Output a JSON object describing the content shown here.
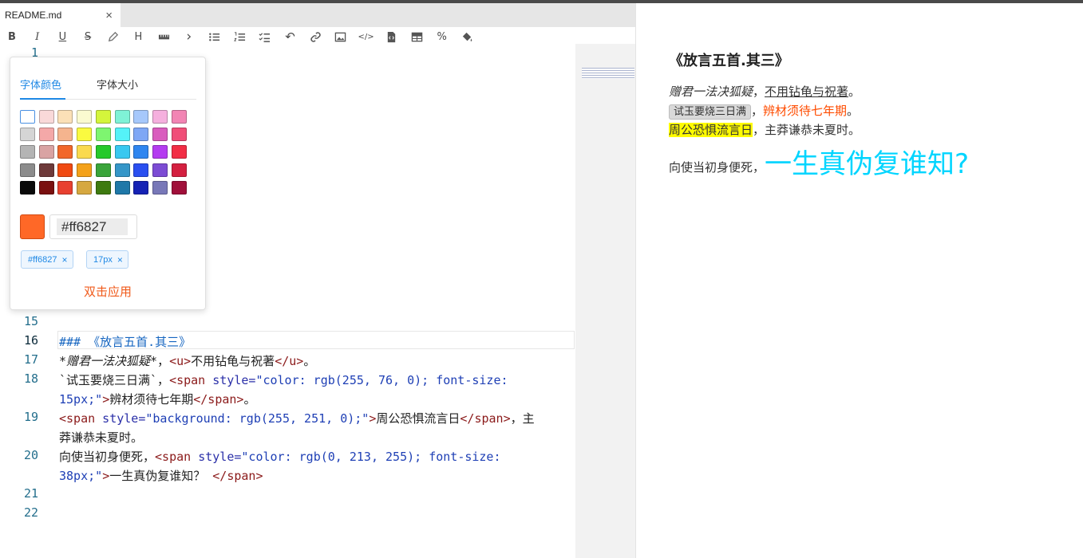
{
  "tab": {
    "title": "README.md",
    "close": "×"
  },
  "toolbar": [
    {
      "name": "bold-icon",
      "glyph": "B"
    },
    {
      "name": "italic-icon",
      "glyph": "I"
    },
    {
      "name": "underline-icon",
      "glyph": "U"
    },
    {
      "name": "strikethrough-icon",
      "glyph": "S"
    },
    {
      "name": "color-pen-icon",
      "glyph": ""
    },
    {
      "name": "heading-icon",
      "glyph": "H"
    },
    {
      "name": "ruler-icon",
      "glyph": ""
    },
    {
      "name": "chevron-right-icon",
      "glyph": "›"
    },
    {
      "name": "unordered-list-icon",
      "glyph": ""
    },
    {
      "name": "ordered-list-icon",
      "glyph": ""
    },
    {
      "name": "checklist-icon",
      "glyph": ""
    },
    {
      "name": "undo-icon",
      "glyph": "↶"
    },
    {
      "name": "link-icon",
      "glyph": ""
    },
    {
      "name": "image-icon",
      "glyph": ""
    },
    {
      "name": "code-icon",
      "glyph": "</>"
    },
    {
      "name": "code-file-icon",
      "glyph": ""
    },
    {
      "name": "table-icon",
      "glyph": ""
    },
    {
      "name": "percent-icon",
      "glyph": "%"
    },
    {
      "name": "paint-bucket-icon",
      "glyph": ""
    }
  ],
  "gutter": {
    "l1": "1",
    "l15": "15",
    "l16": "16",
    "l17": "17",
    "l18": "18",
    "l19": "19",
    "l20": "20",
    "l21": "21",
    "l22": "22"
  },
  "code": {
    "line16_hash": "###",
    "line16_text": " 《放言五首.其三》",
    "line17_star": "*",
    "line17_italic": "赠君一法决狐疑",
    "line17_mid": "*，",
    "line17_u_open": "<u>",
    "line17_u_text": "不用钻龟与祝著",
    "line17_u_close": "</u>",
    "line17_end": "。",
    "line18a_tick": "`试玉要烧三日满`，",
    "line18a_tag": "<span",
    "line18a_attr": " style=",
    "line18a_str": "\"color: rgb(255, 76, 0); font-size:",
    "line18b_str": "15px;\"",
    "line18b_gt": ">",
    "line18b_text": "辨材须待七年期",
    "line18b_close": "</span>",
    "line18b_end": "。",
    "line19a_tag": "<span",
    "line19a_attr": " style=",
    "line19a_str": "\"background: rgb(255, 251, 0);\"",
    "line19a_gt": ">",
    "line19a_text": "周公恐惧流言日",
    "line19a_close": "</span>",
    "line19a_end": "，主",
    "line19b_text": "莽谦恭未夏时。",
    "line20a_text": "向使当初身便死，",
    "line20a_tag": "<span",
    "line20a_attr": " style=",
    "line20a_str": "\"color: rgb(0, 213, 255); font-size:",
    "line20b_str": "38px;\"",
    "line20b_gt": ">",
    "line20b_text": "一生真伪复谁知？ ",
    "line20b_close": "</span>"
  },
  "picker": {
    "tab_color": "字体颜色",
    "tab_size": "字体大小",
    "swatches": [
      [
        "#ffffff",
        "#f9d9d9",
        "#fbe0b7",
        "#fafad0",
        "#d4f53b",
        "#7ff2d6",
        "#a6c8fb",
        "#f5b0de",
        "#f285b4"
      ],
      [
        "#d5d5d5",
        "#f4a8a8",
        "#f5b48e",
        "#fafa40",
        "#7ef570",
        "#55f2f8",
        "#7ea7f5",
        "#d95cbe",
        "#f04e78"
      ],
      [
        "#b4b4b4",
        "#d9a3a3",
        "#f2672a",
        "#fada4e",
        "#25c92a",
        "#38c8f0",
        "#2f86f0",
        "#b43cf0",
        "#f22d45"
      ],
      [
        "#8c8c8c",
        "#6e3a3a",
        "#f04a12",
        "#f4a21a",
        "#3aa43a",
        "#3596c8",
        "#2a4ff0",
        "#7c4cd4",
        "#d42040"
      ],
      [
        "#0a0a0a",
        "#7a1010",
        "#e84030",
        "#d6a840",
        "#3e7a10",
        "#1f78a8",
        "#1522b4",
        "#7878b8",
        "#a0103a"
      ]
    ],
    "current_color": "#ff6827",
    "hex_value": "#ff6827",
    "chip_color": "#ff6827",
    "chip_size": "17px",
    "chip_remove": "×",
    "apply": "双击应用"
  },
  "preview": {
    "title": "《放言五首.其三》",
    "l1_italic": "赠君一法决狐疑",
    "l1_sep": "，",
    "l1_u": "不用钻龟与祝著",
    "l1_end": "。",
    "l2_code": "试玉要烧三日满",
    "l2_sep": "，",
    "l2_colored": "辨材须待七年期",
    "l2_end": "。",
    "l3_hl": "周公恐惧流言日",
    "l3_rest": "，主莽谦恭未夏时。",
    "l4_text": "向使当初身便死，",
    "l4_big": "一生真伪复谁知?",
    "colors": {
      "orange": "#ff4c00",
      "yellow": "#fffb00",
      "cyan": "#00d5ff"
    }
  }
}
